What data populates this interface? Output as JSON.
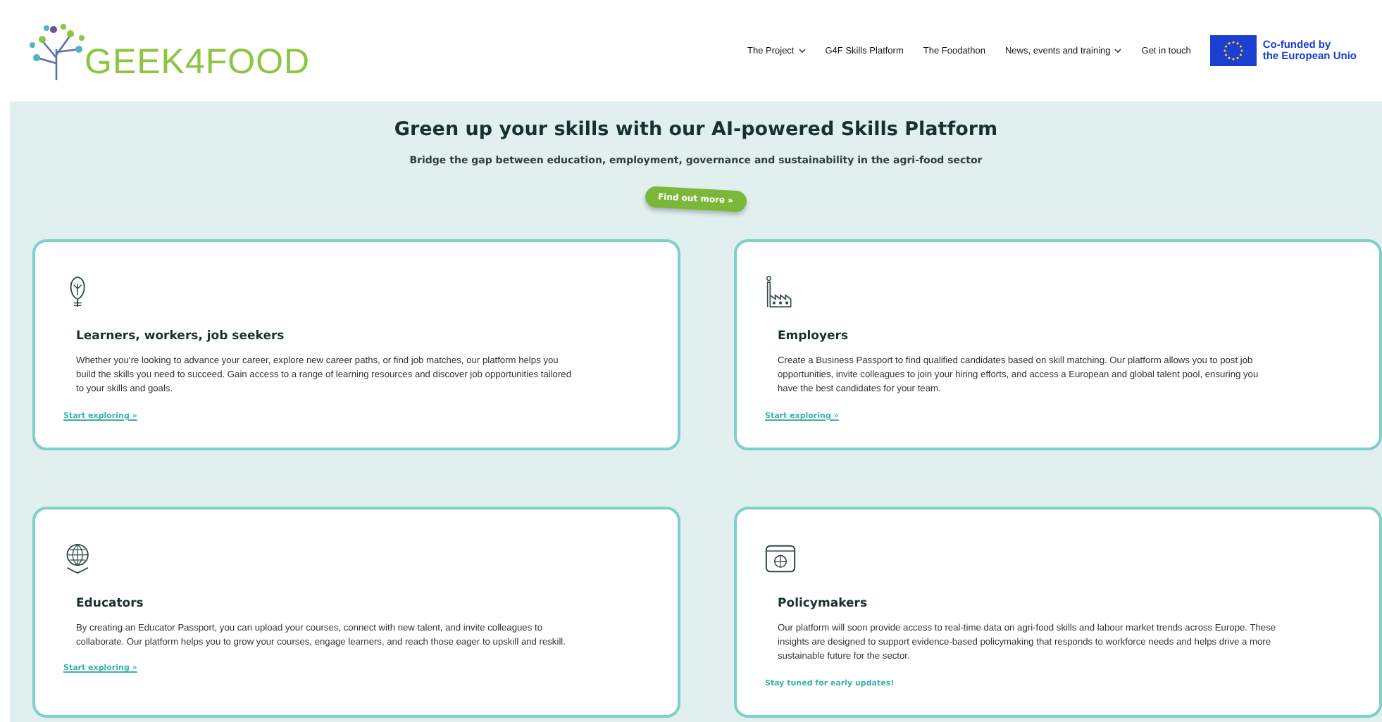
{
  "header": {
    "logo": "GEEK4FOOD",
    "nav": [
      {
        "label": "The Project",
        "has_dropdown": true
      },
      {
        "label": "G4F Skills Platform",
        "has_dropdown": false
      },
      {
        "label": "The Foodathon",
        "has_dropdown": false
      },
      {
        "label": "News, events and training",
        "has_dropdown": true
      },
      {
        "label": "Get in touch",
        "has_dropdown": false
      }
    ],
    "eu_badge": [
      "Co-funded by",
      "the European Unio"
    ]
  },
  "hero": {
    "title": "Green up your skills with our AI-powered Skills Platform",
    "subtitle": "Bridge the gap between education, employment, governance and sustainability in the agri-food sector",
    "button": "Find out more »"
  },
  "cards": [
    {
      "title": "Learners, workers, job seekers",
      "text": "Whether you’re looking to advance your career, explore new career paths, or find job matches, our platform helps you build the skills you need to succeed. Gain access to a range of learning resources and discover job opportunities tailored to your skills and goals.",
      "footer": {
        "kind": "link",
        "text": "Start exploring »"
      }
    },
    {
      "title": "Employers",
      "text": "Create a Business Passport to find qualified candidates based on skill matching. Our platform allows you to post job opportunities, invite colleagues to join your hiring efforts, and access a European and global talent pool, ensuring you have the best candidates for your team.",
      "footer": {
        "kind": "link",
        "text": "Start exploring »"
      }
    },
    {
      "title": "Educators",
      "text": "By creating an Educator Passport, you can upload your courses, connect with new talent, and invite colleagues to collaborate. Our platform helps you to grow your courses, engage learners, and reach those eager to upskill and reskill.",
      "footer": {
        "kind": "link",
        "text": "Start exploring »"
      }
    },
    {
      "title": "Policymakers",
      "text": "Our platform will soon provide access to real-time data on agri-food skills and labour market trends across Europe. These insights are designed to support evidence-based policymaking that responds to workforce needs and helps drive a more sustainable future for the sector.",
      "footer": {
        "kind": "note",
        "text": "Stay tuned for early updates!"
      }
    }
  ]
}
